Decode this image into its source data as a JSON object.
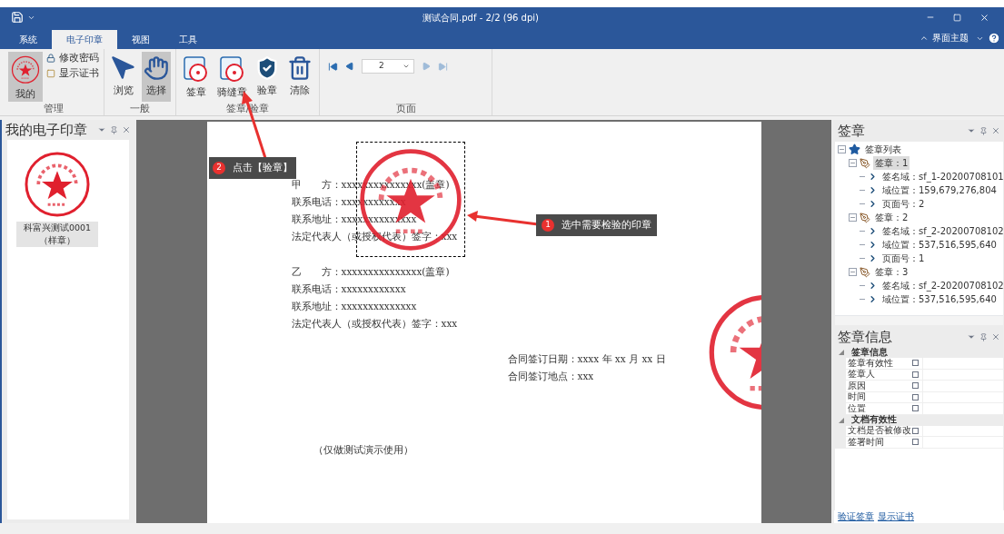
{
  "title_bar": {
    "title": "测试合同.pdf - 2/2 (96 dpi)"
  },
  "ribbon_tabs": [
    {
      "label": "系统",
      "selected": false
    },
    {
      "label": "电子印章",
      "selected": true
    },
    {
      "label": "视图",
      "selected": false
    },
    {
      "label": "工具",
      "selected": false
    }
  ],
  "theme_menu": {
    "label": "界面主题"
  },
  "ribbon_groups": [
    {
      "title": "管理",
      "buttons": [
        {
          "kind": "large",
          "label": "我的",
          "selected": true
        },
        {
          "kind": "small",
          "label": "修改密码"
        },
        {
          "kind": "small",
          "label": "显示证书"
        }
      ]
    },
    {
      "title": "一般",
      "buttons": [
        {
          "kind": "large",
          "label": "浏览",
          "selected": false
        },
        {
          "kind": "large",
          "label": "选择",
          "selected": true
        }
      ]
    },
    {
      "title": "签章/验章",
      "buttons": [
        {
          "kind": "large",
          "label": "签章",
          "selected": false
        },
        {
          "kind": "large",
          "label": "骑缝章",
          "selected": false
        },
        {
          "kind": "large",
          "label": "验章",
          "selected": false
        },
        {
          "kind": "large",
          "label": "清除",
          "selected": false
        }
      ]
    },
    {
      "title": "页面",
      "buttons": [
        {
          "kind": "pager",
          "value": "2"
        }
      ]
    }
  ],
  "stamp_panel": {
    "title": "我的电子印章",
    "stamps": [
      {
        "label": "科富兴测试0001（样章）",
        "selected": true
      }
    ]
  },
  "document": {
    "blocks": [
      {
        "kind": "left",
        "lines": [
          "甲　　方：xxxxxxxxxxxxxxx(盖章)",
          "联系电话：xxxxxxxxxxxx",
          "联系地址：xxxxxxxxxxxxxx",
          "法定代表人（或授权代表）签字：xxx"
        ]
      },
      {
        "kind": "left",
        "lines": [
          "乙　　方：xxxxxxxxxxxxxxx(盖章)",
          "联系电话：xxxxxxxxxxxx",
          "联系地址：xxxxxxxxxxxxxx",
          "法定代表人（或授权代表）签字：xxx"
        ]
      },
      {
        "kind": "right",
        "lines": [
          "合同签订日期：xxxx 年 xx 月 xx 日",
          "合同签订地点：xxx"
        ]
      },
      {
        "kind": "note",
        "lines": [
          "（仅做测试演示使用）"
        ]
      }
    ]
  },
  "callouts": [
    {
      "number": "1",
      "text": "选中需要检验的印章"
    },
    {
      "number": "2",
      "text": "点击【验章】"
    }
  ],
  "signature_panel": {
    "title": "签章",
    "tree": [
      {
        "label": "签章列表",
        "selected": false,
        "expanded": true,
        "children": [
          {
            "label": "签章：1",
            "selected": true,
            "expanded": true,
            "children": [
              {
                "label": "签名域：sf_1-20200708101",
                "selected": false
              },
              {
                "label": "域位置：159,679,276,804",
                "selected": false
              },
              {
                "label": "页面号：2",
                "selected": false
              }
            ]
          },
          {
            "label": "签章：2",
            "selected": false,
            "expanded": true,
            "children": [
              {
                "label": "签名域：sf_2-20200708102",
                "selected": false
              },
              {
                "label": "域位置：537,516,595,640",
                "selected": false
              },
              {
                "label": "页面号：1",
                "selected": false
              }
            ]
          },
          {
            "label": "签章：3",
            "selected": false,
            "expanded": true,
            "children": [
              {
                "label": "签名域：sf_2-20200708102",
                "selected": false
              },
              {
                "label": "域位置：537,516,595,640",
                "selected": false
              }
            ]
          }
        ]
      }
    ]
  },
  "info_panel": {
    "title": "签章信息",
    "categories": [
      {
        "label": "签章信息",
        "expanded": true,
        "rows": [
          "签章有效性",
          "签章人",
          "原因",
          "时间",
          "位置"
        ]
      },
      {
        "label": "文档有效性",
        "expanded": true,
        "rows": [
          "文档是否被修改",
          "签署时间"
        ]
      }
    ],
    "links": [
      "验证签章",
      "显示证书"
    ]
  }
}
